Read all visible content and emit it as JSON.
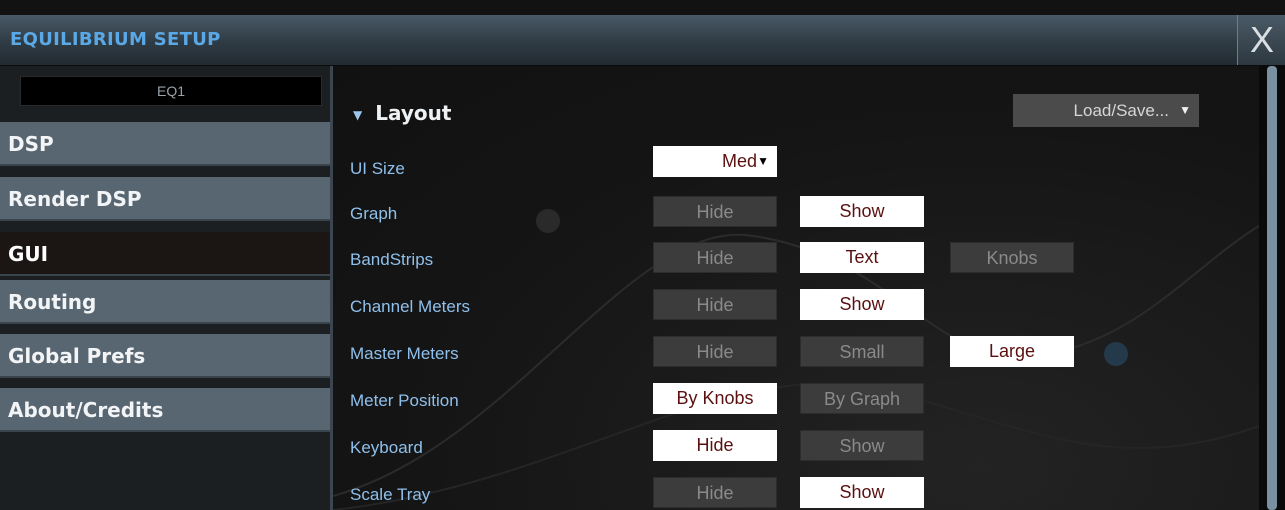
{
  "window": {
    "title": "EQUILIBRIUM SETUP",
    "close_label": "X"
  },
  "sidebar": {
    "preset_name": "EQ1",
    "items": [
      {
        "label": "DSP",
        "active": false
      },
      {
        "label": "Render DSP",
        "active": false
      },
      {
        "label": "GUI",
        "active": true
      },
      {
        "label": "Routing",
        "active": false
      },
      {
        "label": "Global Prefs",
        "active": false
      },
      {
        "label": "About/Credits",
        "active": false
      }
    ]
  },
  "main": {
    "section_title": "Layout",
    "section_arrow": "▼",
    "load_save": {
      "label": "Load/Save...",
      "arrow": "▼"
    },
    "ui_size": {
      "label": "UI Size",
      "value": "Med",
      "arrow": "▼"
    },
    "rows": [
      {
        "label": "Graph",
        "options": [
          "Hide",
          "Show"
        ],
        "selected": "Show"
      },
      {
        "label": "BandStrips",
        "options": [
          "Hide",
          "Text",
          "Knobs"
        ],
        "selected": "Text"
      },
      {
        "label": "Channel Meters",
        "options": [
          "Hide",
          "Show"
        ],
        "selected": "Show"
      },
      {
        "label": "Master Meters",
        "options": [
          "Hide",
          "Small",
          "Large"
        ],
        "selected": "Large"
      },
      {
        "label": "Meter Position",
        "options": [
          "By Knobs",
          "By Graph"
        ],
        "selected": "By Knobs"
      },
      {
        "label": "Keyboard",
        "options": [
          "Hide",
          "Show"
        ],
        "selected": "Hide"
      },
      {
        "label": "Scale Tray",
        "options": [
          "Hide",
          "Show"
        ],
        "selected": "Show"
      }
    ]
  },
  "colors": {
    "title_text": "#5aa8e6",
    "label_text": "#8fc0ec",
    "selected_bg": "#ffffff",
    "selected_text": "#5a1010",
    "unselected_bg": "#3c3c3c",
    "nav_bg": "#586672",
    "nav_active_bg": "#1b1614"
  }
}
